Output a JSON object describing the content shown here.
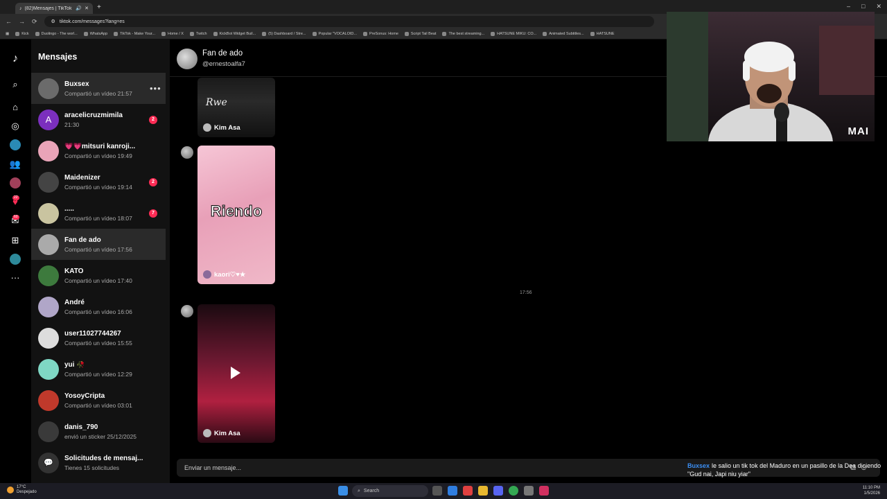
{
  "browser": {
    "tab_title": "(82)Mensajes | TikTok",
    "url": "tiktok.com/messages?lang=es",
    "bookmarks": [
      "Kick",
      "Duolingo - The worl...",
      "WhatsApp",
      "TikTok - Make Your...",
      "Home / X",
      "Twitch",
      "KickBot Widget Buil...",
      "(5) Dashboard / Stre...",
      "Popular \"VOCALOID...",
      "PreSonus: Home",
      "Script Tail Beat",
      "The best streaming...",
      "HATSUNE MIKU: CO...",
      "Animated Subtitles...",
      "HATSUNE"
    ]
  },
  "sidebar": {
    "badges": {
      "friends": "22",
      "inbox": "60"
    }
  },
  "conversations": {
    "header": "Mensajes",
    "items": [
      {
        "name": "Buxsex",
        "sub": "Compartió un vídeo 21:57",
        "unread": "",
        "color": "#6b6b6b"
      },
      {
        "name": "aracelicruzmimila",
        "sub": "21:30",
        "unread": "2",
        "color": "#7b2fbe",
        "initial": "A"
      },
      {
        "name": "💗💗mitsuri kanroji...",
        "sub": "Compartió un vídeo 19:49",
        "unread": "",
        "color": "#e9a4b8"
      },
      {
        "name": "Maidenizer",
        "sub": "Compartió un vídeo 19:14",
        "unread": "2",
        "color": "#444444"
      },
      {
        "name": ".....",
        "sub": "Compartió un vídeo 18:07",
        "unread": "7",
        "color": "#c9c4a0"
      },
      {
        "name": "Fan de ado",
        "sub": "Compartió un vídeo 17:56",
        "unread": "",
        "color": "#aaaaaa"
      },
      {
        "name": "KATO",
        "sub": "Compartió un vídeo 17:40",
        "unread": "",
        "color": "#3d7a3d"
      },
      {
        "name": "André",
        "sub": "Compartió un vídeo 16:06",
        "unread": "",
        "color": "#b0a6c8"
      },
      {
        "name": "user11027744267",
        "sub": "Compartió un vídeo 15:55",
        "unread": "",
        "color": "#dddddd"
      },
      {
        "name": "yui 🥀",
        "sub": "Compartió un vídeo 12:29",
        "unread": "",
        "color": "#7fd7c4"
      },
      {
        "name": "YosoyCripta",
        "sub": "Compartió un vídeo 03:01",
        "unread": "",
        "color": "#c0392b"
      },
      {
        "name": "danis_790",
        "sub": "envió un sticker 25/12/2025",
        "unread": "",
        "color": "#3a3a3a"
      },
      {
        "name": "Solicitudes de mensaj...",
        "sub": "Tienes 15 solicitudes",
        "unread": "",
        "color": "#333333"
      }
    ]
  },
  "chat": {
    "name": "Fan de ado",
    "username": "@ernestoalfa7",
    "videos": [
      {
        "author": "Kim Asa",
        "overlay": "",
        "watermark": "Rwe"
      },
      {
        "author": "kaori♡♥★",
        "overlay": "Riendo"
      },
      {
        "author": "Kim Asa",
        "overlay": ""
      }
    ],
    "timestamp": "17:56",
    "composer_placeholder": "Enviar un mensaje..."
  },
  "stream_chat": {
    "user": "Buxsex",
    "message": "le salio un tik tok del Maduro en un pasillo de la Dea diciendo \"Gud nai, Japi niu yiar\""
  },
  "webcam": {
    "label": "MAI"
  },
  "taskbar": {
    "weather_temp": "17°C",
    "weather_desc": "Despejado",
    "search": "Search",
    "time": "11:10 PM",
    "date": "1/5/2026"
  }
}
